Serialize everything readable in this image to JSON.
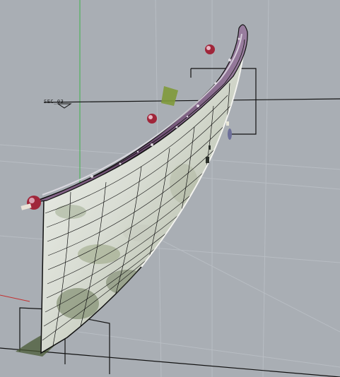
{
  "viewport": {
    "section_label": "SEC_03",
    "colors": {
      "background": "#a9aeb4",
      "grid_line": "#b7bcc2",
      "axis_y": "#3fb24c",
      "axis_x": "#c33030",
      "section_line": "#111111",
      "mesh_light": "#e8ebe6",
      "mesh_shadow": "#6f7a63",
      "scan_purple": "#6a4a6e",
      "scan_red": "#a0263a",
      "moss_green": "#7f9a3a"
    },
    "icons": [
      "section-marker-icon"
    ]
  }
}
